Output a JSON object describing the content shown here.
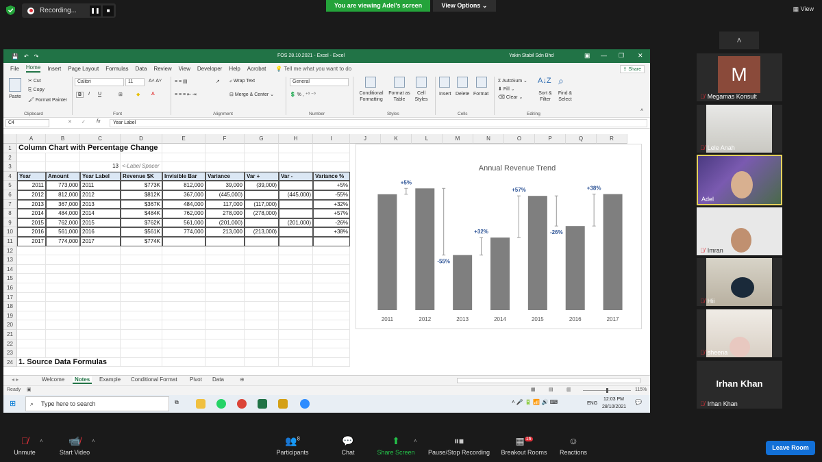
{
  "zoom_top": {
    "recording_label": "Recording...",
    "viewing_label": "You are viewing Adel's screen",
    "view_options_label": "View Options",
    "view_label": "View"
  },
  "excel": {
    "doc_title": "FOS 28.10.2021 - Excel - Excel",
    "account": "Yakin Stabil Sdn Bhd",
    "menu": [
      "File",
      "Home",
      "Insert",
      "Page Layout",
      "Formulas",
      "Data",
      "Review",
      "View",
      "Developer",
      "Help",
      "Acrobat"
    ],
    "tell_me": "Tell me what you want to do",
    "share": "Share",
    "ribbon": {
      "paste": "Paste",
      "cut": "Cut",
      "copy": "Copy",
      "format_painter": "Format Painter",
      "clipboard": "Clipboard",
      "font_name": "Calibri",
      "font_size": "11",
      "font": "Font",
      "wrap_text": "Wrap Text",
      "merge_center": "Merge & Center",
      "alignment": "Alignment",
      "number_format": "General",
      "number": "Number",
      "conditional_formatting": "Conditional Formatting",
      "format_as_table": "Format as Table",
      "cell_styles": "Cell Styles",
      "styles": "Styles",
      "insert": "Insert",
      "delete": "Delete",
      "format": "Format",
      "cells": "Cells",
      "autosum": "AutoSum",
      "fill": "Fill",
      "clear": "Clear",
      "sort_filter": "Sort & Filter",
      "find_select": "Find & Select",
      "editing": "Editing"
    },
    "name_box": "C4",
    "formula": "Year Label",
    "columns": [
      "A",
      "B",
      "C",
      "D",
      "E",
      "F",
      "G",
      "H",
      "I",
      "J",
      "K",
      "L",
      "M",
      "N",
      "O",
      "P",
      "Q",
      "R"
    ],
    "rows": [
      "1",
      "2",
      "3",
      "4",
      "5",
      "6",
      "7",
      "8",
      "9",
      "10",
      "11",
      "12",
      "13",
      "14",
      "15",
      "16",
      "17",
      "18",
      "19",
      "20",
      "21",
      "22",
      "23",
      "24"
    ],
    "a1_title": "Column Chart with Percentage Change",
    "c3_value": "13",
    "d3_note": "<-Label Spacer",
    "table_headers": [
      "Year",
      "Amount",
      "Year Label",
      "Revenue $K",
      "Invisible Bar",
      "Variance",
      "Var +",
      "Var -",
      "Variance %"
    ],
    "table_rows": [
      [
        "2011",
        "773,000",
        "2011",
        "$773K",
        "812,000",
        "39,000",
        "(39,000)",
        "",
        "+5%"
      ],
      [
        "2012",
        "812,000",
        "2012",
        "$812K",
        "367,000",
        "(445,000)",
        "",
        "(445,000)",
        "-55%"
      ],
      [
        "2013",
        "367,000",
        "2013",
        "$367K",
        "484,000",
        "117,000",
        "(117,000)",
        "",
        "+32%"
      ],
      [
        "2014",
        "484,000",
        "2014",
        "$484K",
        "762,000",
        "278,000",
        "(278,000)",
        "",
        "+57%"
      ],
      [
        "2015",
        "762,000",
        "2015",
        "$762K",
        "561,000",
        "(201,000)",
        "",
        "(201,000)",
        "-26%"
      ],
      [
        "2016",
        "561,000",
        "2016",
        "$561K",
        "774,000",
        "213,000",
        "(213,000)",
        "",
        "+38%"
      ],
      [
        "2017",
        "774,000",
        "2017",
        "$774K",
        "",
        "",
        "",
        "",
        ""
      ]
    ],
    "a24_heading": "1. Source Data Formulas",
    "sheet_tabs": [
      "Welcome",
      "Notes",
      "Example",
      "Conditional Format",
      "Pivot",
      "Data"
    ],
    "active_tab": "Notes",
    "status_ready": "Ready",
    "zoom_pct": "115%",
    "taskbar": {
      "search_placeholder": "Type here to search",
      "time": "12:03 PM",
      "date": "28/10/2021",
      "lang": "ENG"
    }
  },
  "chart_data": {
    "type": "bar",
    "title": "Annual Revenue Trend",
    "categories": [
      "2011",
      "2012",
      "2013",
      "2014",
      "2015",
      "2016",
      "2017"
    ],
    "values": [
      773,
      812,
      367,
      484,
      762,
      561,
      774
    ],
    "variance_labels": [
      "+5%",
      "-55%",
      "+32%",
      "+57%",
      "-26%",
      "+38%"
    ],
    "ylim": [
      0,
      900
    ],
    "bar_color": "#7f7f7f",
    "label_color": "#2f5597"
  },
  "participants": [
    {
      "name": "Megamas Konsult",
      "initial": "M",
      "muted": true
    },
    {
      "name": "Lele Anah",
      "muted": true
    },
    {
      "name": "Adel",
      "muted": false,
      "active": true
    },
    {
      "name": "Imran",
      "muted": true
    },
    {
      "name": "Hii",
      "muted": true
    },
    {
      "name": "sheena",
      "muted": true
    },
    {
      "name": "Irhan Khan",
      "display": "Irhan Khan",
      "muted": true
    }
  ],
  "zoom_bar": {
    "unmute": "Unmute",
    "start_video": "Start Video",
    "participants": "Participants",
    "participants_count": "8",
    "chat": "Chat",
    "share_screen": "Share Screen",
    "pause_stop": "Pause/Stop Recording",
    "breakout": "Breakout Rooms",
    "breakout_count": "16",
    "reactions": "Reactions",
    "leave": "Leave Room"
  }
}
